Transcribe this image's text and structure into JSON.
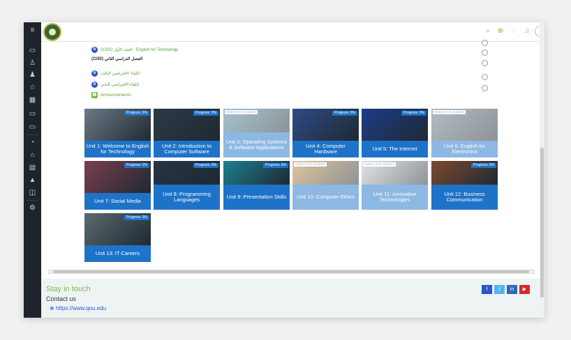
{
  "topbar": {
    "icons": [
      "search-icon",
      "globe-icon",
      "chat-icon",
      "bell-icon",
      "user-avatar-icon"
    ]
  },
  "sidebar": {
    "icons": [
      "menu-icon",
      "folder-icon",
      "user-icon",
      "group-icon",
      "star-icon",
      "calendar-icon",
      "folder-icon",
      "folder-icon",
      "dashboard-icon",
      "home-icon",
      "calendar-icon",
      "graduation-icon",
      "book-icon",
      "gear-icon"
    ]
  },
  "activities": [
    {
      "text": "العقد الأول (1202) - English for Technology",
      "icon": "b"
    },
    {
      "text": "الفصل الدراسي الثاني (1192)",
      "icon": ""
    },
    {
      "text": "اللقاء الافتراضي الثالث",
      "icon": "b"
    },
    {
      "text": "اللقاء الافتراضي الثاني",
      "icon": "b"
    },
    {
      "text": "Announcements",
      "icon": "chat"
    }
  ],
  "tiles": [
    {
      "title": "Unit 1: Welcome to English for Technology",
      "badge": "Progress: 0%",
      "hidden": "",
      "dim": false,
      "big": false,
      "img": "#6d7a86"
    },
    {
      "title": "Unit 2: Introduction to Computer Software",
      "badge": "Progress: 0%",
      "hidden": "",
      "dim": false,
      "big": false,
      "img": "#2d3a45"
    },
    {
      "title": "Unit 3: Operating Systems & Software Applications",
      "badge": "",
      "hidden": "Hidden from students",
      "dim": true,
      "big": true,
      "img": "#4a8aa2"
    },
    {
      "title": "Unit 4: Computer Hardware",
      "badge": "Progress: 0%",
      "hidden": "",
      "dim": false,
      "big": false,
      "img": "#2e4b86"
    },
    {
      "title": "Unit 5: The Internet",
      "badge": "Progress: 0%",
      "hidden": "",
      "dim": false,
      "big": false,
      "img": "#1b3d8a"
    },
    {
      "title": "Unit 6: English for Electronics",
      "badge": "",
      "hidden": "Hidden from students",
      "dim": true,
      "big": false,
      "img": "#6a7c86"
    },
    {
      "title": "Unit 7: Social Media",
      "badge": "Progress: 0%",
      "hidden": "",
      "dim": false,
      "big": false,
      "img": "#7a3f4f"
    },
    {
      "title": "Unit 8: Programming Languages",
      "badge": "Progress: 0%",
      "hidden": "",
      "dim": false,
      "big": true,
      "img": "#263444"
    },
    {
      "title": "Unit 9: Presentation Skills",
      "badge": "Progress: 0%",
      "hidden": "",
      "dim": false,
      "big": true,
      "img": "#1d8090"
    },
    {
      "title": "Unit 10: Computer Ethics",
      "badge": "",
      "hidden": "Hidden from students",
      "dim": true,
      "big": true,
      "img": "#c08c3a"
    },
    {
      "title": "Unit 11: Innovative Technologies",
      "badge": "",
      "hidden": "Hidden from students",
      "dim": true,
      "big": true,
      "img": "#c9c9c9"
    },
    {
      "title": "Unit 12: Business Communication",
      "badge": "Progress: 0%",
      "hidden": "",
      "dim": false,
      "big": true,
      "img": "#7d4a2e"
    },
    {
      "title": "Unit 13: IT Careers",
      "badge": "Progress: 0%",
      "hidden": "",
      "dim": false,
      "big": false,
      "img": "#5a6b6e"
    }
  ],
  "footer": {
    "title": "Stay in touch",
    "contact": "Contact us",
    "link": "https://www.qou.edu",
    "social": [
      {
        "name": "facebook-icon",
        "glyph": "f",
        "color": "#2c56c7"
      },
      {
        "name": "twitter-icon",
        "glyph": "t",
        "color": "#57b4f0"
      },
      {
        "name": "linkedin-icon",
        "glyph": "in",
        "color": "#2f69b8"
      },
      {
        "name": "youtube-icon",
        "glyph": "▶",
        "color": "#d62a2a"
      }
    ]
  }
}
